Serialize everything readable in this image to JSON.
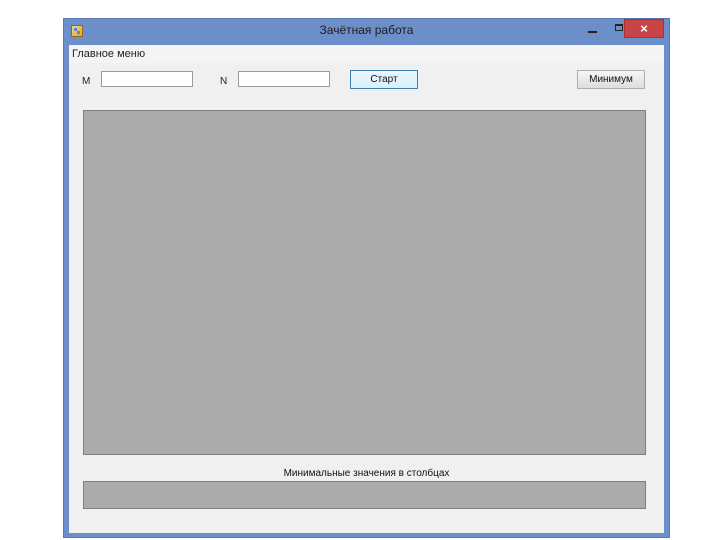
{
  "window": {
    "title": "Зачётная работа",
    "close_glyph": "×"
  },
  "menu": {
    "main_menu_label": "Главное меню"
  },
  "controls": {
    "m_label": "M",
    "m_value": "",
    "n_label": "N",
    "n_value": "",
    "start_label": "Старт",
    "minimum_label": "Минимум"
  },
  "results": {
    "min_values_label": "Минимальные значения в столбцах"
  },
  "icons": {
    "app": "app-icon",
    "minimize": "minimize-icon",
    "maximize": "maximize-icon",
    "close": "close-icon"
  },
  "colors": {
    "title_bar": "#6d8fc9",
    "close_button": "#c94444",
    "grid_background": "#ababab",
    "client_background": "#f0f0f0"
  }
}
